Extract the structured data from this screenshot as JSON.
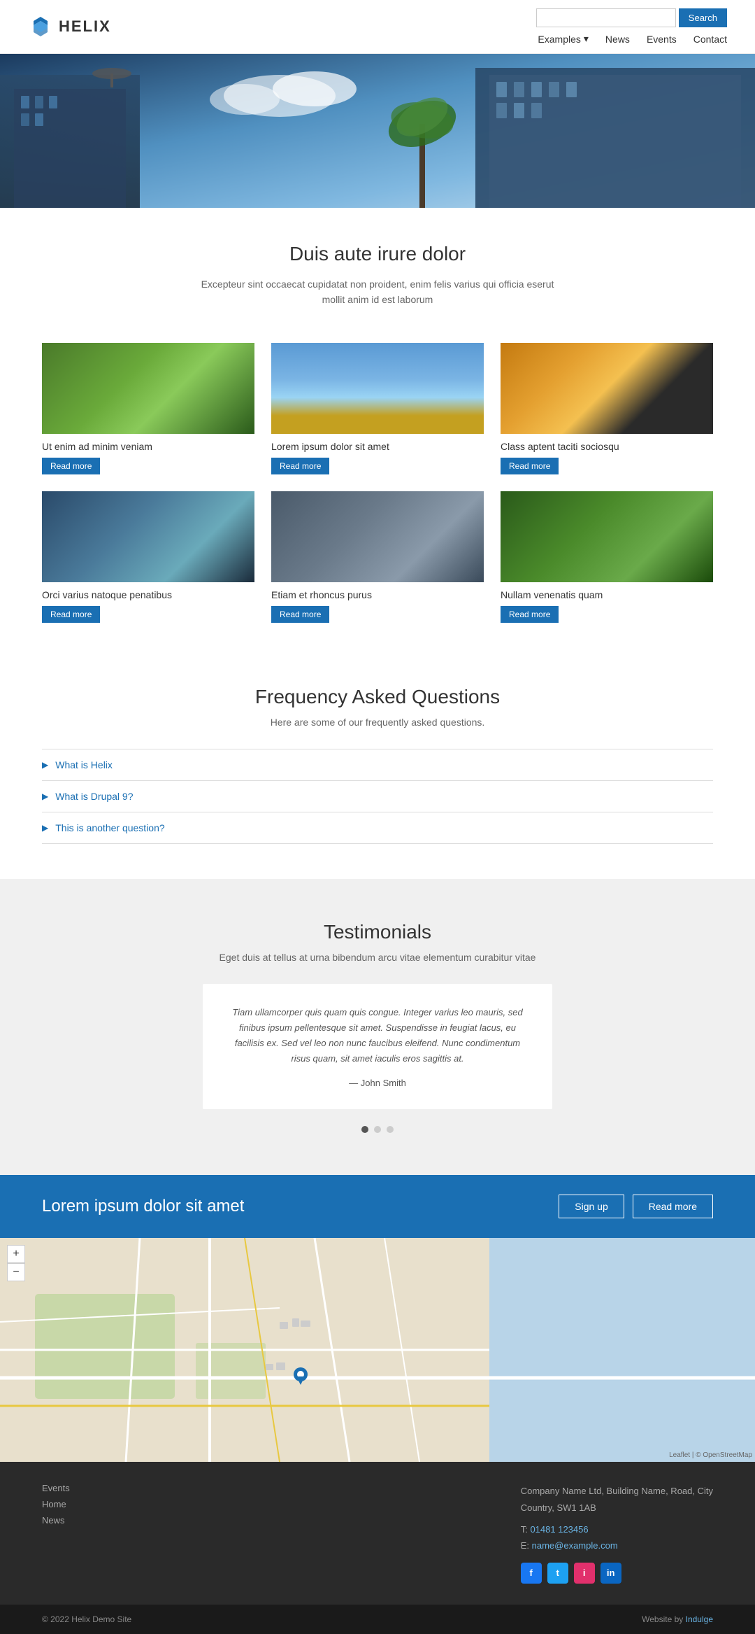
{
  "header": {
    "logo_text": "HELIX",
    "search_placeholder": "",
    "search_button": "Search",
    "nav": {
      "examples": "Examples",
      "news": "News",
      "events": "Events",
      "contact": "Contact"
    }
  },
  "intro": {
    "title": "Duis aute irure dolor",
    "subtitle": "Excepteur sint occaecat cupidatat non proident, enim felis varius qui officia eserut\nmollit anim id est laborum"
  },
  "cards": [
    {
      "title": "Ut enim ad minim veniam",
      "btn": "Read more",
      "img_class": "img-waterfall"
    },
    {
      "title": "Lorem ipsum dolor sit amet",
      "btn": "Read more",
      "img_class": "img-windmill"
    },
    {
      "title": "Class aptent taciti sociosqu",
      "btn": "Read more",
      "img_class": "img-solar"
    },
    {
      "title": "Orci varius natoque penatibus",
      "btn": "Read more",
      "img_class": "img-dome"
    },
    {
      "title": "Etiam et rhoncus purus",
      "btn": "Read more",
      "img_class": "img-building"
    },
    {
      "title": "Nullam venenatis quam",
      "btn": "Read more",
      "img_class": "img-garden"
    }
  ],
  "faq": {
    "title": "Frequency Asked Questions",
    "subtitle": "Here are some of our frequently asked questions.",
    "items": [
      {
        "question": "What is Helix"
      },
      {
        "question": "What is Drupal 9?"
      },
      {
        "question": "This is another question?"
      }
    ]
  },
  "testimonials": {
    "title": "Testimonials",
    "subtitle": "Eget duis at tellus at urna bibendum arcu vitae elementum curabitur vitae",
    "items": [
      {
        "text": "Tiam ullamcorper quis quam quis congue. Integer varius leo mauris, sed finibus ipsum pellentesque sit amet. Suspendisse in feugiat lacus, eu facilisis ex. Sed vel leo non nunc faucibus eleifend. Nunc condimentum risus quam, sit amet iaculis eros sagittis at.",
        "author": "— John Smith"
      }
    ]
  },
  "cta": {
    "title": "Lorem ipsum dolor sit amet",
    "signup_btn": "Sign up",
    "readmore_btn": "Read more"
  },
  "map": {
    "zoom_in": "+",
    "zoom_out": "−",
    "attribution": "Leaflet | © OpenStreetMap"
  },
  "footer": {
    "links": [
      {
        "label": "Events"
      },
      {
        "label": "Home"
      },
      {
        "label": "News"
      }
    ],
    "company": "Company Name Ltd, Building Name, Road, City",
    "country": "Country, SW1 1AB",
    "phone_label": "T:",
    "phone": "01481 123456",
    "email_label": "E:",
    "email": "name@example.com",
    "social": [
      {
        "name": "Facebook",
        "letter": "f",
        "class": "social-facebook"
      },
      {
        "name": "Twitter",
        "letter": "t",
        "class": "social-twitter"
      },
      {
        "name": "Instagram",
        "letter": "i",
        "class": "social-instagram"
      },
      {
        "name": "LinkedIn",
        "letter": "in",
        "class": "social-linkedin"
      }
    ],
    "copyright": "© 2022 Helix Demo Site",
    "credit_text": "Website by",
    "credit_link": "Indulge"
  }
}
